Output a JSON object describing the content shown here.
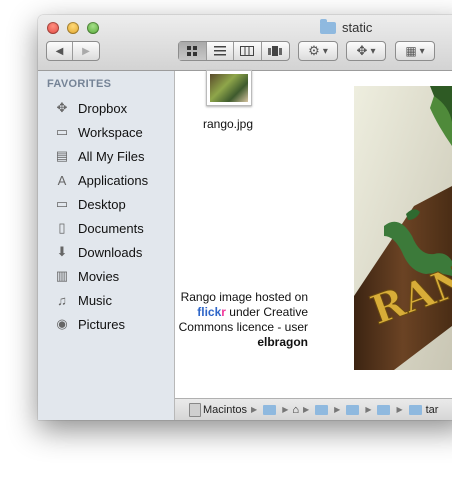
{
  "window": {
    "title": "static"
  },
  "toolbar": {
    "back_glyph": "◀",
    "forward_glyph": "▶",
    "view_icons": [
      "icon-view-icon",
      "list-view-icon",
      "column-view-icon",
      "coverflow-view-icon"
    ],
    "action_glyph": "⚙",
    "dropdown_glyph": "▾",
    "dropbox_glyph": "✥",
    "arrange_glyph": "▦"
  },
  "sidebar": {
    "header": "FAVORITES",
    "items": [
      {
        "label": "Dropbox",
        "icon": "dropbox-icon",
        "glyph": "✥"
      },
      {
        "label": "Workspace",
        "icon": "folder-icon",
        "glyph": "▭"
      },
      {
        "label": "All My Files",
        "icon": "all-files-icon",
        "glyph": "▤"
      },
      {
        "label": "Applications",
        "icon": "applications-icon",
        "glyph": "A"
      },
      {
        "label": "Desktop",
        "icon": "desktop-icon",
        "glyph": "▭"
      },
      {
        "label": "Documents",
        "icon": "documents-icon",
        "glyph": "▯"
      },
      {
        "label": "Downloads",
        "icon": "downloads-icon",
        "glyph": "⬇"
      },
      {
        "label": "Movies",
        "icon": "movies-icon",
        "glyph": "▥"
      },
      {
        "label": "Music",
        "icon": "music-icon",
        "glyph": "♫"
      },
      {
        "label": "Pictures",
        "icon": "pictures-icon",
        "glyph": "◉"
      }
    ]
  },
  "content": {
    "file": {
      "name": "rango.jpg"
    },
    "credit": {
      "line1": "Rango image hosted on",
      "flickr_a": "flick",
      "flickr_b": "r",
      "line2_rest": " under Creative",
      "line3": "Commons licence - user",
      "line4": "elbragon"
    }
  },
  "pathbar": {
    "items": [
      "Macintos",
      "",
      "",
      "",
      "",
      "",
      "",
      "tar"
    ]
  },
  "colors": {
    "flickr_blue": "#2f66c8",
    "flickr_pink": "#f0379a",
    "sidebar_bg": "#e2e7ed"
  }
}
